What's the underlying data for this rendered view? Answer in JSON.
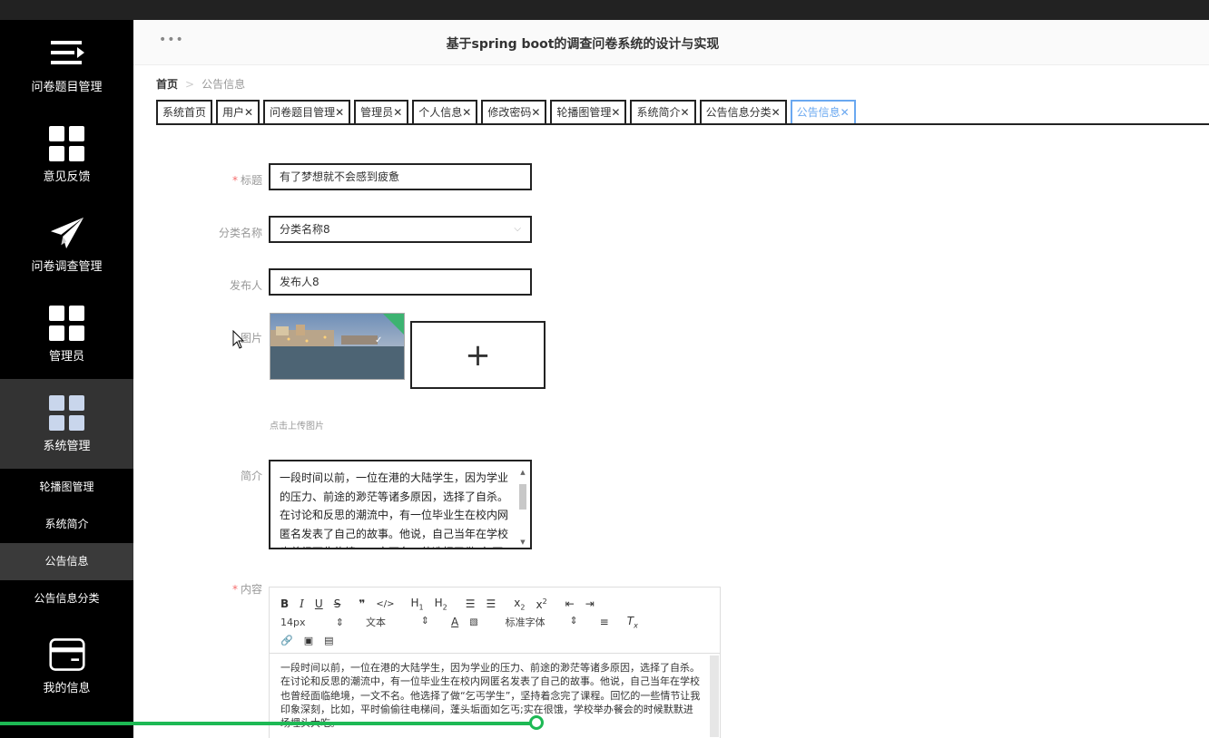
{
  "app": {
    "title": "基于spring boot的调查问卷系统的设计与实现"
  },
  "sidebar": {
    "items": [
      {
        "label": "问卷题目管理",
        "icon": "list-icon"
      },
      {
        "label": "意见反馈",
        "icon": "grid-icon"
      },
      {
        "label": "问卷调查管理",
        "icon": "paper-plane-icon"
      },
      {
        "label": "管理员",
        "icon": "grid-icon"
      },
      {
        "label": "系统管理",
        "icon": "grid-icon"
      }
    ],
    "subitems": [
      {
        "label": "轮播图管理"
      },
      {
        "label": "系统简介"
      },
      {
        "label": "公告信息"
      },
      {
        "label": "公告信息分类"
      }
    ],
    "bottom": {
      "label": "我的信息",
      "icon": "wallet-icon"
    }
  },
  "breadcrumb": {
    "home": "首页",
    "separator": ">",
    "current": "公告信息"
  },
  "tabs": [
    {
      "label": "系统首页",
      "closable": false
    },
    {
      "label": "用户",
      "closable": true
    },
    {
      "label": "问卷题目管理",
      "closable": true
    },
    {
      "label": "管理员",
      "closable": true
    },
    {
      "label": "个人信息",
      "closable": true
    },
    {
      "label": "修改密码",
      "closable": true
    },
    {
      "label": "轮播图管理",
      "closable": true
    },
    {
      "label": "系统简介",
      "closable": true
    },
    {
      "label": "公告信息分类",
      "closable": true
    },
    {
      "label": "公告信息",
      "closable": true
    }
  ],
  "form": {
    "title_label": "标题",
    "title_value": "有了梦想就不会感到疲惫",
    "category_label": "分类名称",
    "category_value": "分类名称8",
    "publisher_label": "发布人",
    "publisher_value": "发布人8",
    "image_label": "图片",
    "upload_tip": "点击上传图片",
    "intro_label": "简介",
    "intro_value": "一段时间以前，一位在港的大陆学生，因为学业的压力、前途的渺茫等诸多原因，选择了自杀。在讨论和反思的潮流中，有一位毕业生在校内网匿名发表了自己的故事。他说，自己当年在学校也曾经面临绝境，一文不名。他选择了做“乞丐",
    "content_label": "内容",
    "content_value": "一段时间以前，一位在港的大陆学生，因为学业的压力、前途的渺茫等诸多原因，选择了自杀。在讨论和反思的潮流中，有一位毕业生在校内网匿名发表了自己的故事。他说，自己当年在学校也曾经面临绝境，一文不名。他选择了做“乞丐学生”，坚持着念完了课程。回忆的一些情节让我印象深刻，比如，平时偷偷往电梯间，蓬头垢面如乞丐;实在很饿，学校举办餐会的时候默默进场埋头大吃。"
  },
  "editor": {
    "font_size": "14px",
    "text_type": "文本",
    "font_family": "标准字体"
  },
  "progress": {
    "played_fraction": 0.444
  }
}
